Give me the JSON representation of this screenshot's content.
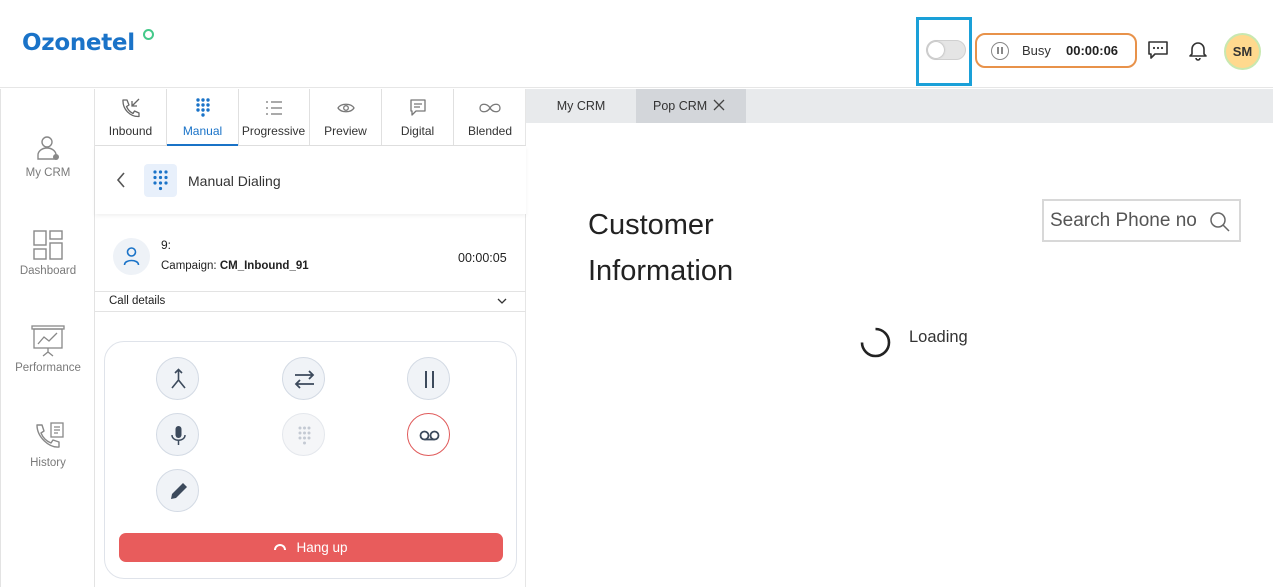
{
  "header": {
    "logo": "Ozonetel",
    "status": {
      "label": "Busy",
      "timer": "00:00:06",
      "toggle_on": false
    },
    "avatar_initials": "SM",
    "icons": [
      "chat-icon",
      "bell-icon",
      "pause-icon"
    ],
    "colors": {
      "brand": "#1a73c8",
      "status_border": "#e8924a",
      "highlight": "#1aa0d8",
      "avatar_bg": "#ffd98e"
    }
  },
  "left_nav": {
    "items": [
      {
        "label": "My CRM",
        "icon": "agent-icon"
      },
      {
        "label": "Dashboard",
        "icon": "dashboard-icon"
      },
      {
        "label": "Performance",
        "icon": "performance-icon"
      },
      {
        "label": "History",
        "icon": "history-icon"
      }
    ]
  },
  "dialer": {
    "tabs": [
      {
        "label": "Inbound",
        "icon": "inbound-call-icon"
      },
      {
        "label": "Manual",
        "icon": "dialpad-icon",
        "active": true
      },
      {
        "label": "Progressive",
        "icon": "list-icon"
      },
      {
        "label": "Preview",
        "icon": "eye-icon"
      },
      {
        "label": "Digital",
        "icon": "message-icon"
      },
      {
        "label": "Blended",
        "icon": "infinity-icon"
      }
    ],
    "title": "Manual Dialing",
    "call": {
      "number": "9:",
      "campaign_label": "Campaign:",
      "campaign": "CM_Inbound_91",
      "timer": "00:00:05"
    },
    "call_details_label": "Call details",
    "controls": [
      "merge-icon",
      "transfer-icon",
      "pause-icon",
      "mic-icon",
      "dialpad-icon",
      "record-icon",
      "edit-icon"
    ],
    "hangup_label": "Hang up",
    "colors": {
      "hangup": "#e85c5c",
      "record": "#e05a5a"
    }
  },
  "crm": {
    "tabs": [
      {
        "label": "My CRM"
      },
      {
        "label": "Pop CRM",
        "active": true
      }
    ],
    "title_line1": "Customer",
    "title_line2": "Information",
    "search": {
      "placeholder": "Search Phone no",
      "value": ""
    },
    "loading_text": "Loading"
  }
}
